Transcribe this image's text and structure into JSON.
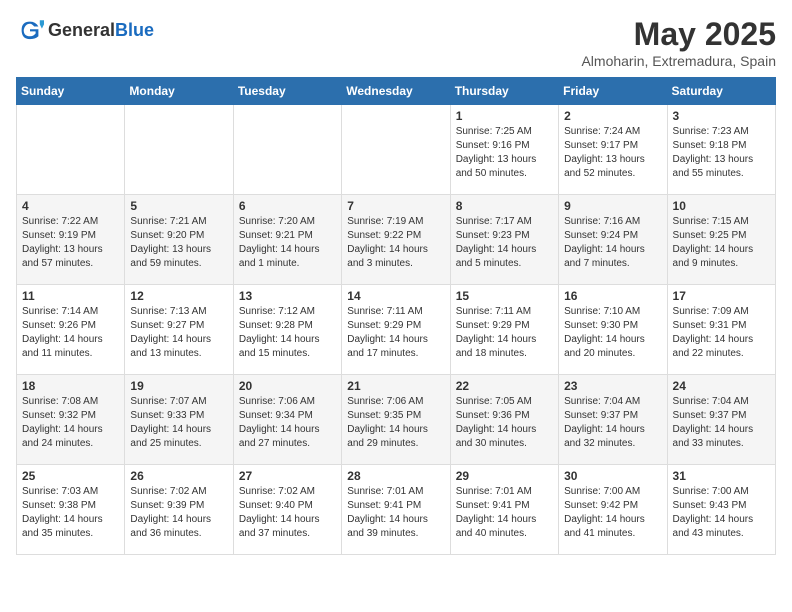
{
  "header": {
    "logo_general": "General",
    "logo_blue": "Blue",
    "title": "May 2025",
    "subtitle": "Almoharin, Extremadura, Spain"
  },
  "days_of_week": [
    "Sunday",
    "Monday",
    "Tuesday",
    "Wednesday",
    "Thursday",
    "Friday",
    "Saturday"
  ],
  "weeks": [
    {
      "days": [
        {
          "num": "",
          "info": ""
        },
        {
          "num": "",
          "info": ""
        },
        {
          "num": "",
          "info": ""
        },
        {
          "num": "",
          "info": ""
        },
        {
          "num": "1",
          "info": "Sunrise: 7:25 AM\nSunset: 9:16 PM\nDaylight: 13 hours\nand 50 minutes."
        },
        {
          "num": "2",
          "info": "Sunrise: 7:24 AM\nSunset: 9:17 PM\nDaylight: 13 hours\nand 52 minutes."
        },
        {
          "num": "3",
          "info": "Sunrise: 7:23 AM\nSunset: 9:18 PM\nDaylight: 13 hours\nand 55 minutes."
        }
      ]
    },
    {
      "days": [
        {
          "num": "4",
          "info": "Sunrise: 7:22 AM\nSunset: 9:19 PM\nDaylight: 13 hours\nand 57 minutes."
        },
        {
          "num": "5",
          "info": "Sunrise: 7:21 AM\nSunset: 9:20 PM\nDaylight: 13 hours\nand 59 minutes."
        },
        {
          "num": "6",
          "info": "Sunrise: 7:20 AM\nSunset: 9:21 PM\nDaylight: 14 hours\nand 1 minute."
        },
        {
          "num": "7",
          "info": "Sunrise: 7:19 AM\nSunset: 9:22 PM\nDaylight: 14 hours\nand 3 minutes."
        },
        {
          "num": "8",
          "info": "Sunrise: 7:17 AM\nSunset: 9:23 PM\nDaylight: 14 hours\nand 5 minutes."
        },
        {
          "num": "9",
          "info": "Sunrise: 7:16 AM\nSunset: 9:24 PM\nDaylight: 14 hours\nand 7 minutes."
        },
        {
          "num": "10",
          "info": "Sunrise: 7:15 AM\nSunset: 9:25 PM\nDaylight: 14 hours\nand 9 minutes."
        }
      ]
    },
    {
      "days": [
        {
          "num": "11",
          "info": "Sunrise: 7:14 AM\nSunset: 9:26 PM\nDaylight: 14 hours\nand 11 minutes."
        },
        {
          "num": "12",
          "info": "Sunrise: 7:13 AM\nSunset: 9:27 PM\nDaylight: 14 hours\nand 13 minutes."
        },
        {
          "num": "13",
          "info": "Sunrise: 7:12 AM\nSunset: 9:28 PM\nDaylight: 14 hours\nand 15 minutes."
        },
        {
          "num": "14",
          "info": "Sunrise: 7:11 AM\nSunset: 9:29 PM\nDaylight: 14 hours\nand 17 minutes."
        },
        {
          "num": "15",
          "info": "Sunrise: 7:11 AM\nSunset: 9:29 PM\nDaylight: 14 hours\nand 18 minutes."
        },
        {
          "num": "16",
          "info": "Sunrise: 7:10 AM\nSunset: 9:30 PM\nDaylight: 14 hours\nand 20 minutes."
        },
        {
          "num": "17",
          "info": "Sunrise: 7:09 AM\nSunset: 9:31 PM\nDaylight: 14 hours\nand 22 minutes."
        }
      ]
    },
    {
      "days": [
        {
          "num": "18",
          "info": "Sunrise: 7:08 AM\nSunset: 9:32 PM\nDaylight: 14 hours\nand 24 minutes."
        },
        {
          "num": "19",
          "info": "Sunrise: 7:07 AM\nSunset: 9:33 PM\nDaylight: 14 hours\nand 25 minutes."
        },
        {
          "num": "20",
          "info": "Sunrise: 7:06 AM\nSunset: 9:34 PM\nDaylight: 14 hours\nand 27 minutes."
        },
        {
          "num": "21",
          "info": "Sunrise: 7:06 AM\nSunset: 9:35 PM\nDaylight: 14 hours\nand 29 minutes."
        },
        {
          "num": "22",
          "info": "Sunrise: 7:05 AM\nSunset: 9:36 PM\nDaylight: 14 hours\nand 30 minutes."
        },
        {
          "num": "23",
          "info": "Sunrise: 7:04 AM\nSunset: 9:37 PM\nDaylight: 14 hours\nand 32 minutes."
        },
        {
          "num": "24",
          "info": "Sunrise: 7:04 AM\nSunset: 9:37 PM\nDaylight: 14 hours\nand 33 minutes."
        }
      ]
    },
    {
      "days": [
        {
          "num": "25",
          "info": "Sunrise: 7:03 AM\nSunset: 9:38 PM\nDaylight: 14 hours\nand 35 minutes."
        },
        {
          "num": "26",
          "info": "Sunrise: 7:02 AM\nSunset: 9:39 PM\nDaylight: 14 hours\nand 36 minutes."
        },
        {
          "num": "27",
          "info": "Sunrise: 7:02 AM\nSunset: 9:40 PM\nDaylight: 14 hours\nand 37 minutes."
        },
        {
          "num": "28",
          "info": "Sunrise: 7:01 AM\nSunset: 9:41 PM\nDaylight: 14 hours\nand 39 minutes."
        },
        {
          "num": "29",
          "info": "Sunrise: 7:01 AM\nSunset: 9:41 PM\nDaylight: 14 hours\nand 40 minutes."
        },
        {
          "num": "30",
          "info": "Sunrise: 7:00 AM\nSunset: 9:42 PM\nDaylight: 14 hours\nand 41 minutes."
        },
        {
          "num": "31",
          "info": "Sunrise: 7:00 AM\nSunset: 9:43 PM\nDaylight: 14 hours\nand 43 minutes."
        }
      ]
    }
  ]
}
